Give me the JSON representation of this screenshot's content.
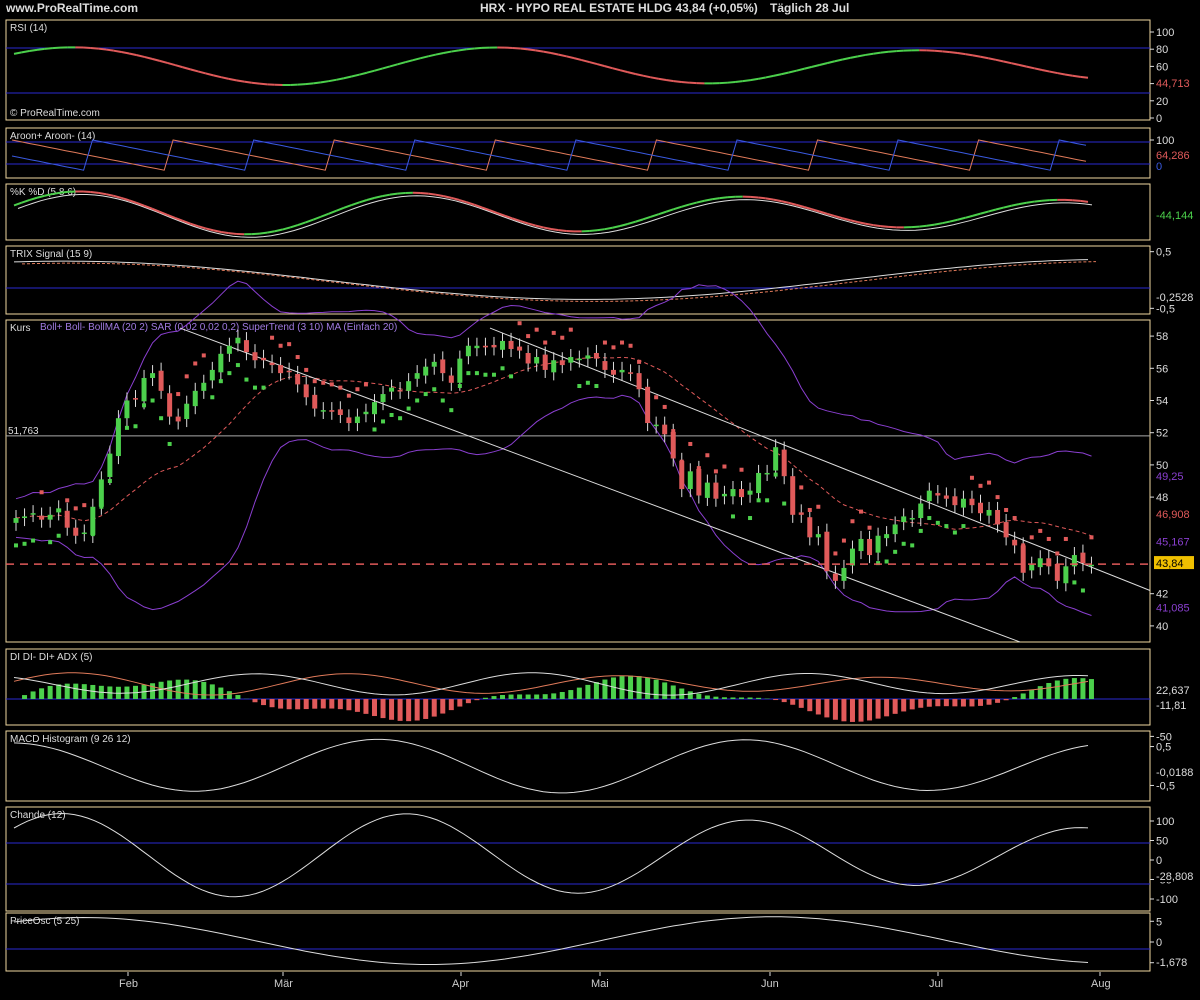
{
  "header": {
    "site": "www.ProRealTime.com",
    "title": "HRX - HYPO REAL ESTATE HLDG    43,84 (+0,05%)",
    "period": "Täglich  28 Jul"
  },
  "watermark": "© ProRealTime.com",
  "x_axis": [
    "Feb",
    "Mär",
    "Apr",
    "Mai",
    "Jun",
    "Jul",
    "Aug"
  ],
  "panels": {
    "rsi": {
      "label": "RSI (14)",
      "ticks": [
        "100",
        "80",
        "60",
        "40",
        "20",
        "0"
      ],
      "value": "44,713"
    },
    "aroon": {
      "label": "Aroon+ Aroon- (14)",
      "ticks": [
        "100"
      ],
      "value": "64,286",
      "value2": "0"
    },
    "stoch": {
      "label": "%K %D (5 8 6)",
      "value": "-44,144"
    },
    "trix": {
      "label": "TRIX Signal (15 9)",
      "ticks": [
        "0,5",
        "-0,5"
      ],
      "value": "-0,2528"
    },
    "price": {
      "label": "Kurs",
      "indicators": "Boll+ Boll- BollMA (20 2)   SAR (0,02 0,02 0,2)   SuperTrend (3 10)   MA (Einfach 20)",
      "ticks": [
        "58",
        "56",
        "54",
        "52",
        "50",
        "48",
        "42",
        "40"
      ],
      "hline_label": "51,763",
      "boll_upper": "49,25",
      "supertrend": "46,908",
      "ma": "45,167",
      "last": "43,84",
      "boll_lower": "41,085"
    },
    "dmi": {
      "label": "DI DI- DI+ ADX (5)",
      "ticks": [
        "-50"
      ],
      "value": "22,637",
      "value2": "-11,81"
    },
    "macd": {
      "label": "MACD Histogram (9 26 12)",
      "ticks": [
        "0,5",
        "-0,5"
      ],
      "value": "-0,0188"
    },
    "chande": {
      "label": "Chande (12)",
      "ticks": [
        "100",
        "50",
        "0",
        "-50",
        "-100"
      ],
      "value": "-28,808"
    },
    "priceosc": {
      "label": "PriceOsc (5 25)",
      "ticks": [
        "5",
        "0",
        "-5"
      ],
      "value": "-1,678"
    }
  },
  "colors": {
    "bull": "#4cd04c",
    "bear": "#e05a5a",
    "boll": "#8a3fd0",
    "line": "#dddddd",
    "grid": "#2a2ad0",
    "label": "#f0c000"
  },
  "chart_data": {
    "type": "candlestick",
    "title": "HRX - HYPO REAL ESTATE HLDG",
    "x": [
      "Feb",
      "Mär",
      "Apr",
      "Mai",
      "Jun",
      "Jul",
      "Aug"
    ],
    "ylim": [
      39,
      59
    ],
    "close": [
      46.7,
      46.8,
      47.0,
      46.6,
      46.9,
      47.3,
      46.1,
      45.6,
      45.8,
      47.4,
      49.1,
      50.7,
      52.9,
      54.0,
      54.1,
      55.4,
      55.7,
      54.6,
      53.0,
      52.7,
      53.8,
      54.6,
      55.1,
      55.9,
      56.9,
      57.4,
      57.9,
      57.0,
      56.5,
      56.5,
      56.2,
      55.7,
      55.8,
      55.0,
      54.2,
      53.5,
      53.4,
      53.3,
      53.1,
      52.6,
      53.0,
      53.3,
      53.9,
      54.4,
      54.8,
      54.6,
      55.2,
      55.7,
      56.1,
      56.4,
      55.7,
      55.1,
      56.6,
      57.4,
      57.4,
      57.3,
      57.3,
      57.7,
      57.2,
      57.1,
      56.3,
      56.7,
      55.9,
      56.5,
      56.2,
      56.7,
      56.6,
      56.8,
      56.6,
      55.9,
      55.6,
      55.9,
      55.7,
      54.7,
      52.6,
      52.5,
      51.9,
      50.4,
      48.5,
      49.6,
      48.1,
      48.9,
      47.9,
      48.2,
      48.5,
      48.0,
      48.4,
      49.5,
      49.5,
      51.1,
      49.3,
      46.9,
      46.9,
      45.5,
      45.7,
      43.4,
      42.8,
      43.6,
      44.8,
      45.4,
      44.4,
      45.6,
      45.7,
      46.3,
      46.8,
      46.7,
      47.6,
      48.4,
      48.1,
      47.9,
      47.5,
      47.9,
      47.5,
      47.0,
      47.2,
      46.3,
      45.5,
      45.0,
      43.3,
      43.8,
      44.2,
      43.7,
      42.8,
      43.7,
      44.4,
      43.9,
      43.8
    ]
  }
}
